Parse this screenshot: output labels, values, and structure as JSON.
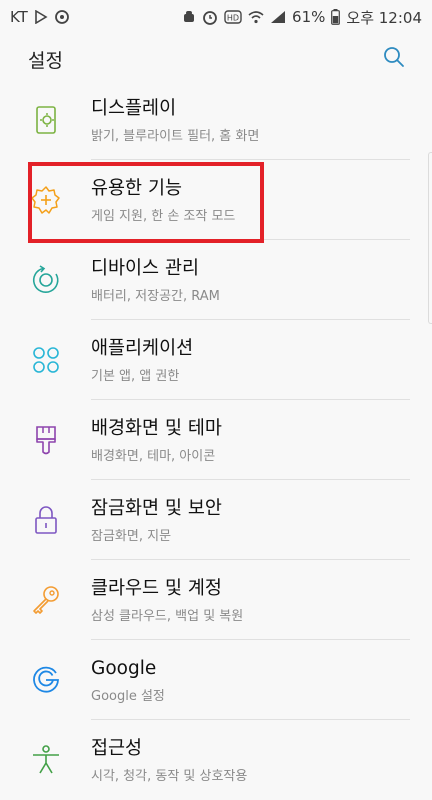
{
  "status_bar": {
    "carrier": "KT",
    "battery": "61%",
    "time": "오후 12:04",
    "icons": [
      "play-store-icon",
      "sync-icon",
      "android-icon",
      "alarm-icon",
      "hd-icon",
      "wifi-icon",
      "signal-icon",
      "battery-icon"
    ]
  },
  "header": {
    "title": "설정",
    "search_icon": "search-icon"
  },
  "items": [
    {
      "title": "디스플레이",
      "subtitle": "밝기, 블루라이트 필터, 홈 화면",
      "icon": "display-icon",
      "color": "#7cb342"
    },
    {
      "title": "유용한 기능",
      "subtitle": "게임 지원, 한 손 조작 모드",
      "icon": "advanced-features-icon",
      "color": "#f4a01a"
    },
    {
      "title": "디바이스 관리",
      "subtitle": "배터리, 저장공간, RAM",
      "icon": "device-maintenance-icon",
      "color": "#26a69a"
    },
    {
      "title": "애플리케이션",
      "subtitle": "기본 앱, 앱 권한",
      "icon": "apps-icon",
      "color": "#29b6d6"
    },
    {
      "title": "배경화면 및 테마",
      "subtitle": "배경화면, 테마, 아이콘",
      "icon": "theme-brush-icon",
      "color": "#8e44ad"
    },
    {
      "title": "잠금화면 및 보안",
      "subtitle": "잠금화면, 지문",
      "icon": "lock-icon",
      "color": "#7e57c2"
    },
    {
      "title": "클라우드 및 계정",
      "subtitle": "삼성 클라우드, 백업 및 복원",
      "icon": "key-icon",
      "color": "#f39c32"
    },
    {
      "title": "Google",
      "subtitle": "Google 설정",
      "icon": "google-icon",
      "color": "#1e88e5"
    },
    {
      "title": "접근성",
      "subtitle": "시각, 청각, 동작 및 상호작용",
      "icon": "accessibility-icon",
      "color": "#43a047"
    }
  ],
  "highlight": {
    "color": "#e32128"
  }
}
